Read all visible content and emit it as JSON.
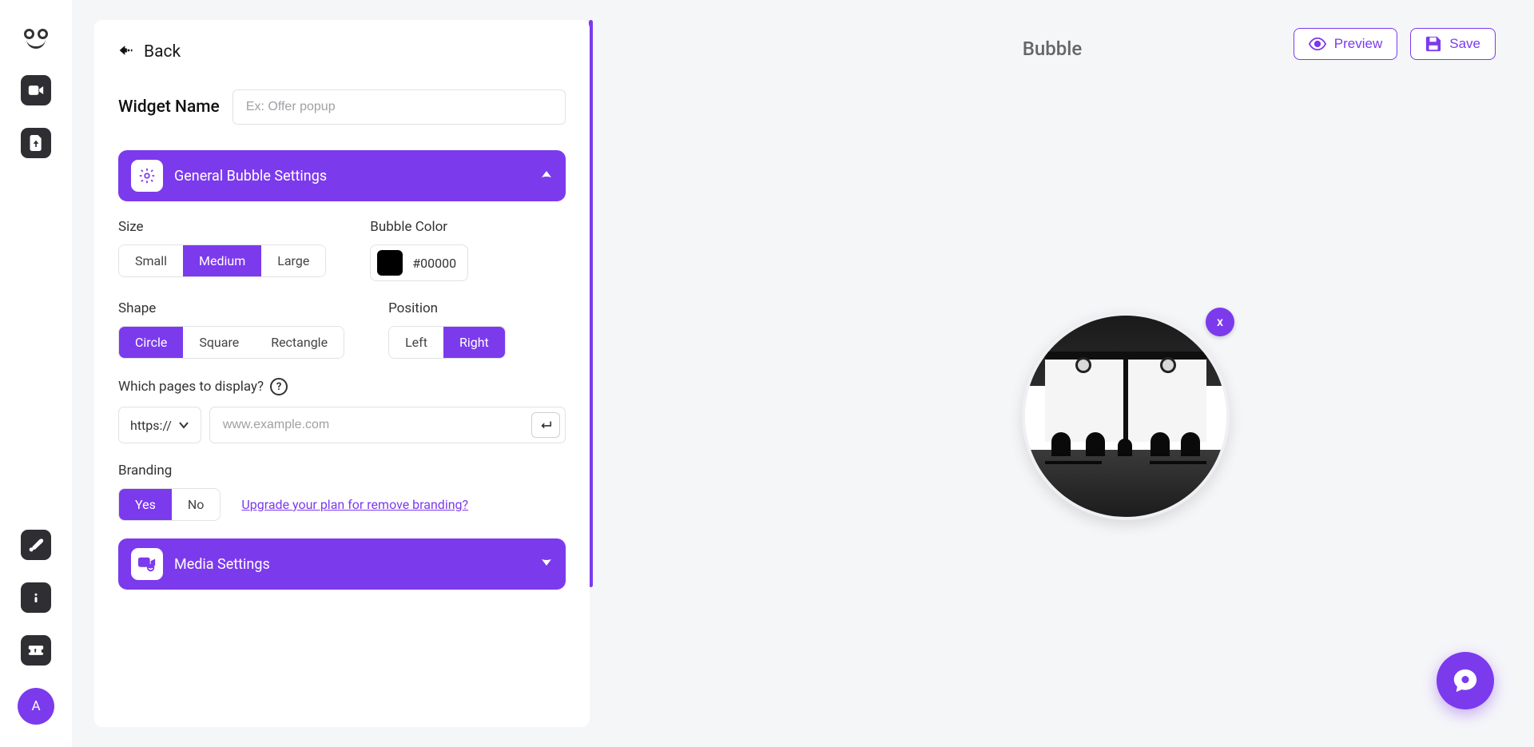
{
  "sidebar": {
    "avatar_letter": "A"
  },
  "panel": {
    "back_label": "Back",
    "widget_name_label": "Widget Name",
    "widget_name_placeholder": "Ex: Offer popup",
    "general_header": "General Bubble Settings",
    "size_label": "Size",
    "size_options": {
      "small": "Small",
      "medium": "Medium",
      "large": "Large"
    },
    "bubble_color_label": "Bubble Color",
    "bubble_color_value": "#00000",
    "shape_label": "Shape",
    "shape_options": {
      "circle": "Circle",
      "square": "Square",
      "rectangle": "Rectangle"
    },
    "position_label": "Position",
    "position_options": {
      "left": "Left",
      "right": "Right"
    },
    "pages_label": "Which pages to display?",
    "protocol_value": "https://",
    "url_placeholder": "www.example.com",
    "branding_label": "Branding",
    "branding_options": {
      "yes": "Yes",
      "no": "No"
    },
    "upgrade_link": "Upgrade your plan for remove branding?",
    "media_header": "Media Settings"
  },
  "preview": {
    "title": "Bubble",
    "preview_button": "Preview",
    "save_button": "Save",
    "close_glyph": "x"
  }
}
